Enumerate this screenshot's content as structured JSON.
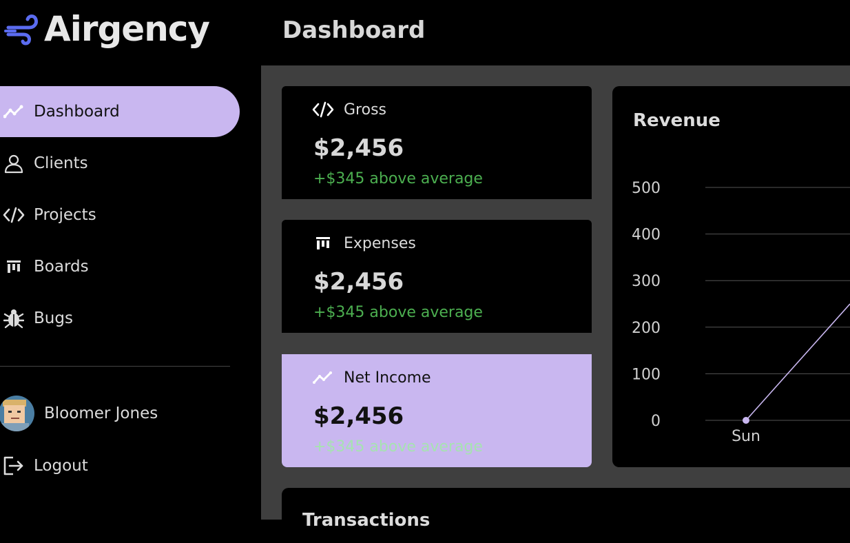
{
  "app": {
    "brand": "Airgency",
    "page_title": "Dashboard"
  },
  "sidebar": {
    "items": [
      {
        "label": "Dashboard",
        "icon": "trend-line-icon",
        "active": true
      },
      {
        "label": "Clients",
        "icon": "person-icon",
        "active": false
      },
      {
        "label": "Projects",
        "icon": "code-icon",
        "active": false
      },
      {
        "label": "Boards",
        "icon": "board-columns-icon",
        "active": false
      },
      {
        "label": "Bugs",
        "icon": "bug-icon",
        "active": false
      }
    ],
    "user": {
      "name": "Bloomer Jones"
    },
    "logout_label": "Logout"
  },
  "cards": [
    {
      "label": "Gross",
      "icon": "code-icon",
      "value": "$2,456",
      "delta": "+$345 above average"
    },
    {
      "label": "Expenses",
      "icon": "board-columns-icon",
      "value": "$2,456",
      "delta": "+$345 above average"
    },
    {
      "label": "Net Income",
      "icon": "trend-line-icon",
      "value": "$2,456",
      "delta": "+$345 above average",
      "highlighted": true
    }
  ],
  "revenue": {
    "title": "Revenue"
  },
  "transactions": {
    "title": "Transactions"
  },
  "colors": {
    "accent": "#c9b7f0",
    "positive": "#4caf50",
    "panel_bg": "#3f3f3f",
    "sidebar_bg": "#000000"
  },
  "chart_data": {
    "type": "line",
    "x": [
      "Sun"
    ],
    "yticks": [
      0,
      100,
      200,
      300,
      400,
      500
    ],
    "ylim": [
      0,
      500
    ],
    "series": [
      {
        "values": [
          0
        ]
      }
    ],
    "line_color": "#c9b7f0",
    "grid": true
  }
}
